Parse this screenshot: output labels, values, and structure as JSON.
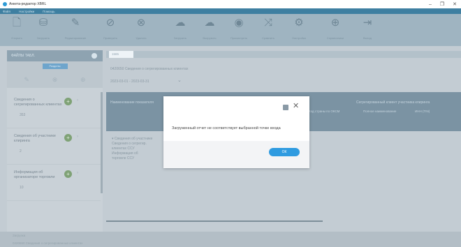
{
  "window": {
    "title": "Анкета-редактор XBRL",
    "controls": {
      "minimize": "–",
      "maximize": "❐",
      "close": "✕"
    }
  },
  "menu": [
    "Файл",
    "Настройки",
    "Помощь"
  ],
  "ribbon": [
    {
      "label": "Открыть",
      "icon": "open-file-icon",
      "glyph": "🗋"
    },
    {
      "label": "Загрузить",
      "icon": "database-icon",
      "glyph": "⛁"
    },
    {
      "label": "Редактирование",
      "icon": "pencil-icon",
      "glyph": "✎"
    },
    {
      "label": "Проверить",
      "icon": "check-icon",
      "glyph": "⊘"
    },
    {
      "label": "Удалить",
      "icon": "delete-icon",
      "glyph": "⊗"
    },
    {
      "label": "Загрузить",
      "icon": "cloud-upload-icon",
      "glyph": "☁"
    },
    {
      "label": "Выгрузить",
      "icon": "cloud-download-icon",
      "glyph": "☁"
    },
    {
      "label": "Просмотреть",
      "icon": "eye-icon",
      "glyph": "◉"
    },
    {
      "label": "Сравнить",
      "icon": "compare-icon",
      "glyph": "⤨"
    },
    {
      "label": "Настройки",
      "icon": "settings-icon",
      "glyph": "⚙"
    },
    {
      "label": "Справочники",
      "icon": "globe-icon",
      "glyph": "⊕"
    },
    {
      "label": "Выход",
      "icon": "exit-icon",
      "glyph": "⇥"
    }
  ],
  "left_panel": {
    "header": "ФАЙЛЫ ТАБЛ.",
    "active_tab": "Разделы",
    "tools": [
      "✎",
      "⊗",
      "⊕"
    ],
    "items": [
      {
        "title": "Сведения о сегрегированных клиентах",
        "count": "353"
      },
      {
        "title": "Сведения об участнике клиринга",
        "count": "2"
      },
      {
        "title": "Информация об организаторе торговли",
        "count": "10"
      }
    ]
  },
  "main": {
    "tab_label": "1585",
    "subtitle": "0420650 Сведения о сегрегированных клиентах",
    "period": "2023-03-01 - 2023-03-31",
    "grid_headers": {
      "name": "Наименование показателя",
      "group": "Сегрегированный клиент участника клиринга",
      "country_code": "Код страны по ОКСМ",
      "full_name": "Полное наименование",
      "inn": "ИНН (TIN)"
    },
    "tree": [
      "▾ Сведения об участнике",
      "  Сведения о сегрегир.",
      "  клиентах ССУ",
      "    Информация об",
      "    торговле ССУ"
    ]
  },
  "status": {
    "line1": "Загрузка",
    "line2": "0420650 Сведения о сегрегированных клиентах"
  },
  "modal": {
    "message": "Загруженный отчет не соответствует выбранной точке входа",
    "ok_label": "ОК",
    "close_glyph": "✕"
  }
}
